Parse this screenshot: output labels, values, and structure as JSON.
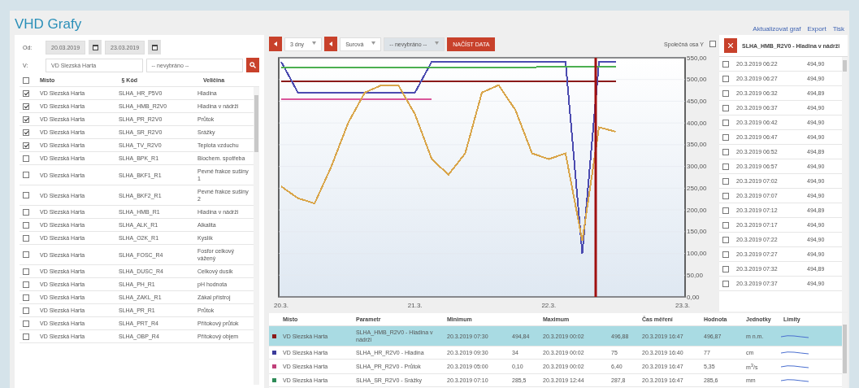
{
  "title": "VHD Grafy",
  "links": [
    "Aktualizovat graf",
    "Export",
    "Tisk"
  ],
  "filters": {
    "date_label": "Od:",
    "date_from": "20.03.2019",
    "date_to": "23.03.2019",
    "place_label": "V:",
    "place": "VD Slezská Harta",
    "place_select": "-- nevybráno --"
  },
  "left_table": {
    "header_checked": false,
    "columns": [
      "Místo",
      "§ Kód",
      "Veličina"
    ],
    "rows": [
      {
        "checked": true,
        "place": "VD Slezská Harta",
        "code": "SLHA_HR_P5V0",
        "quantity": "Hladina"
      },
      {
        "checked": true,
        "place": "VD Slezská Harta",
        "code": "SLHA_HMB_R2V0",
        "quantity": "Hladina v nádrži"
      },
      {
        "checked": true,
        "place": "VD Slezská Harta",
        "code": "SLHA_PR_R2V0",
        "quantity": "Průtok"
      },
      {
        "checked": true,
        "place": "VD Slezská Harta",
        "code": "SLHA_SR_R2V0",
        "quantity": "Srážky"
      },
      {
        "checked": true,
        "place": "VD Slezská Harta",
        "code": "SLHA_TV_R2V0",
        "quantity": "Teplota vzduchu"
      },
      {
        "checked": false,
        "place": "VD Slezská Harta",
        "code": "SLHA_BPK_R1",
        "quantity": "Biochem. spotřeba"
      },
      {
        "checked": false,
        "place": "VD Slezská Harta",
        "code": "SLHA_BKF1_R1",
        "quantity": "Pevné frakce sušiny 1"
      },
      {
        "checked": false,
        "place": "VD Slezská Harta",
        "code": "SLHA_BKF2_R1",
        "quantity": "Pevné frakce sušiny 2"
      },
      {
        "checked": false,
        "place": "VD Slezská Harta",
        "code": "SLHA_HMB_R1",
        "quantity": "Hladina v nádrži"
      },
      {
        "checked": false,
        "place": "VD Slezská Harta",
        "code": "SLHA_ALK_R1",
        "quantity": "Alkalita"
      },
      {
        "checked": false,
        "place": "VD Slezská Harta",
        "code": "SLHA_O2K_R1",
        "quantity": "Kyslík"
      },
      {
        "checked": false,
        "place": "VD Slezská Harta",
        "code": "SLHA_FOSC_R4",
        "quantity": "Fosfor celkový vážený"
      },
      {
        "checked": false,
        "place": "VD Slezská Harta",
        "code": "SLHA_DUSC_R4",
        "quantity": "Celkový dusík"
      },
      {
        "checked": false,
        "place": "VD Slezská Harta",
        "code": "SLHA_PH_R1",
        "quantity": "pH hodnota"
      },
      {
        "checked": false,
        "place": "VD Slezská Harta",
        "code": "SLHA_ZAKL_R1",
        "quantity": "Zákal přístroj"
      },
      {
        "checked": false,
        "place": "VD Slezská Harta",
        "code": "SLHA_PR_R1",
        "quantity": "Průtok"
      },
      {
        "checked": false,
        "place": "VD Slezská Harta",
        "code": "SLHA_PRT_R4",
        "quantity": "Přítokový průtok"
      },
      {
        "checked": false,
        "place": "VD Slezská Harta",
        "code": "SLHA_OBP_R4",
        "quantity": "Přítokový objem"
      }
    ]
  },
  "toolbar": {
    "period": "3 dny",
    "data_type": "Surová",
    "select": "-- nevybráno --",
    "load_button": "NAČÍST DATA",
    "common_axis": {
      "label": "Společná osa Y",
      "checked": false
    }
  },
  "chart": {
    "chart_data": {
      "type": "line",
      "categories": [
        "20.3.",
        null,
        null,
        null,
        null,
        null,
        null,
        null,
        "21.3.",
        null,
        null,
        null,
        null,
        null,
        null,
        null,
        "22.3.",
        null,
        null,
        null,
        null,
        null,
        null,
        null,
        "23.3."
      ],
      "ylim": [
        0,
        550
      ],
      "grid": true,
      "yticks": [
        {
          "value": 0,
          "label": "0,00"
        },
        {
          "value": 50,
          "label": "50,00"
        },
        {
          "value": 100,
          "label": "100,00"
        },
        {
          "value": 150,
          "label": "150,00"
        },
        {
          "value": 200,
          "label": "200,00"
        },
        {
          "value": 250,
          "label": "250,00"
        },
        {
          "value": 300,
          "label": "300,00"
        },
        {
          "value": 350,
          "label": "350,00"
        },
        {
          "value": 400,
          "label": "400,00"
        },
        {
          "value": 450,
          "label": "450,00"
        },
        {
          "value": 500,
          "label": "500,00"
        },
        {
          "value": 550,
          "label": "550,00"
        }
      ],
      "series": [
        {
          "color": "#8b1a1a",
          "values": [
            496,
            496,
            496,
            496,
            496,
            496,
            496,
            496,
            496,
            496,
            496,
            496,
            496,
            496,
            496,
            496,
            496,
            496,
            496,
            496,
            496,
            null,
            null,
            null,
            null
          ]
        },
        {
          "color": "#4b4bb0",
          "values": [
            541,
            470,
            470,
            470,
            470,
            470,
            470,
            470,
            470,
            541,
            541,
            541,
            541,
            541,
            541,
            541,
            541,
            541,
            100,
            541,
            541,
            null,
            null,
            null,
            null
          ]
        },
        {
          "color": "#d9569b",
          "values": [
            455,
            455,
            455,
            455,
            455,
            455,
            455,
            455,
            455,
            455,
            null,
            null,
            null,
            null,
            null,
            null,
            null,
            null,
            null,
            null,
            null,
            null,
            null,
            null,
            null
          ]
        },
        {
          "color": "#4caf50",
          "values": [
            528,
            528,
            528,
            528,
            528,
            528,
            528,
            528,
            528,
            528,
            528,
            528,
            528,
            528,
            528,
            528,
            530,
            530,
            530,
            530,
            530,
            null,
            null,
            null,
            null
          ]
        },
        {
          "color": "#d9a54a",
          "values": [
            254,
            227,
            215,
            300,
            400,
            470,
            487,
            487,
            420,
            317,
            281,
            330,
            470,
            487,
            430,
            330,
            317,
            330,
            129,
            390,
            380,
            null,
            null,
            null,
            null
          ]
        }
      ]
    }
  },
  "side_panel": {
    "title": "SLHA_HMB_R2V0 - Hladina v nádrži",
    "rows": [
      {
        "checked": false,
        "time": "20.3.2019 06:22",
        "value": "494,90"
      },
      {
        "checked": false,
        "time": "20.3.2019 06:27",
        "value": "494,90"
      },
      {
        "checked": false,
        "time": "20.3.2019 06:32",
        "value": "494,89"
      },
      {
        "checked": false,
        "time": "20.3.2019 06:37",
        "value": "494,90"
      },
      {
        "checked": false,
        "time": "20.3.2019 06:42",
        "value": "494,90"
      },
      {
        "checked": false,
        "time": "20.3.2019 06:47",
        "value": "494,90"
      },
      {
        "checked": false,
        "time": "20.3.2019 06:52",
        "value": "494,89"
      },
      {
        "checked": false,
        "time": "20.3.2019 06:57",
        "value": "494,90"
      },
      {
        "checked": false,
        "time": "20.3.2019 07:02",
        "value": "494,90"
      },
      {
        "checked": false,
        "time": "20.3.2019 07:07",
        "value": "494,90"
      },
      {
        "checked": false,
        "time": "20.3.2019 07:12",
        "value": "494,89"
      },
      {
        "checked": false,
        "time": "20.3.2019 07:17",
        "value": "494,90"
      },
      {
        "checked": false,
        "time": "20.3.2019 07:22",
        "value": "494,90"
      },
      {
        "checked": false,
        "time": "20.3.2019 07:27",
        "value": "494,90"
      },
      {
        "checked": false,
        "time": "20.3.2019 07:32",
        "value": "494,89"
      },
      {
        "checked": false,
        "time": "20.3.2019 07:37",
        "value": "494,90"
      }
    ]
  },
  "summary_table": {
    "columns": [
      "Místo",
      "Parametr",
      "Minimum",
      "Maximum",
      "Čas měření",
      "Hodnota",
      "Jednotky",
      "Limity"
    ],
    "rows": [
      {
        "selected": true,
        "color": "#8b1a1a",
        "place": "VD Slezská Harta",
        "parameter": "SLHA_HMB_R2V0 - Hladina v nádrži",
        "min_time": "20.3.2019 07:30",
        "min": "494,84",
        "max_time": "20.3.2019 00:02",
        "max": "496,88",
        "time": "20.3.2019 16:47",
        "value": "496,87",
        "unit": "m n.m."
      },
      {
        "selected": false,
        "color": "#3b3b9a",
        "place": "VD Slezská Harta",
        "parameter": "SLHA_HR_R2V0 - Hladina",
        "min_time": "20.3.2019 09:30",
        "min": "34",
        "max_time": "20.3.2019 00:02",
        "max": "75",
        "time": "20.3.2019 16:40",
        "value": "77",
        "unit": "cm"
      },
      {
        "selected": false,
        "color": "#c0407a",
        "place": "VD Slezská Harta",
        "parameter": "SLHA_PR_R2V0 - Průtok",
        "min_time": "20.3.2019 05:00",
        "min": "0,10",
        "max_time": "20.3.2019 00:02",
        "max": "6,40",
        "time": "20.3.2019 16:47",
        "value": "5,35",
        "unit": "m$^{3}$/s"
      },
      {
        "selected": false,
        "color": "#2e8b57",
        "place": "VD Slezská Harta",
        "parameter": "SLHA_SR_R2V0 - Srážky",
        "min_time": "20.3.2019 07:10",
        "min": "285,5",
        "max_time": "20.3.2019 12:44",
        "max": "287,8",
        "time": "20.3.2019 16:47",
        "value": "285,6",
        "unit": "mm"
      }
    ]
  }
}
